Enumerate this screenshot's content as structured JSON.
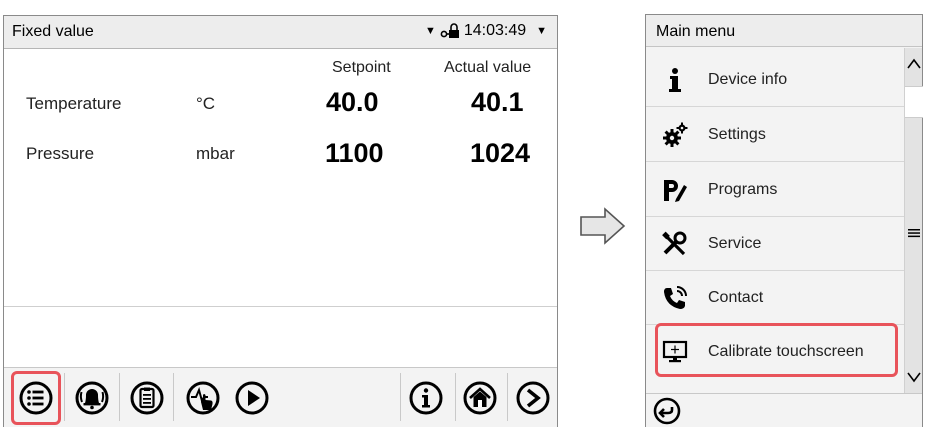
{
  "left_screen": {
    "title": "Fixed value",
    "time": "14:03:49",
    "columns": {
      "setpoint": "Setpoint",
      "actual": "Actual value"
    },
    "rows": [
      {
        "label": "Temperature",
        "unit": "°C",
        "setpoint": "40.0",
        "actual": "40.1"
      },
      {
        "label": "Pressure",
        "unit": "mbar",
        "setpoint": "1100",
        "actual": "1024"
      }
    ],
    "toolbar_icons": [
      "menu-list-icon",
      "alarm-bell-icon",
      "clipboard-icon",
      "user-mode-hand-icon",
      "play-icon",
      "info-icon",
      "home-icon",
      "next-arrow-icon"
    ]
  },
  "right_screen": {
    "title": "Main menu",
    "items": [
      {
        "label": "Device info",
        "icon": "info-i-icon"
      },
      {
        "label": "Settings",
        "icon": "gears-icon"
      },
      {
        "label": "Programs",
        "icon": "programs-icon"
      },
      {
        "label": "Service",
        "icon": "service-tools-icon"
      },
      {
        "label": "Contact",
        "icon": "phone-icon"
      },
      {
        "label": "Calibrate touchscreen",
        "icon": "monitor-calibrate-icon"
      }
    ]
  },
  "colors": {
    "highlight": "#e8535a",
    "header_bg": "#ededed",
    "panel_bg": "#f3f3f3"
  }
}
